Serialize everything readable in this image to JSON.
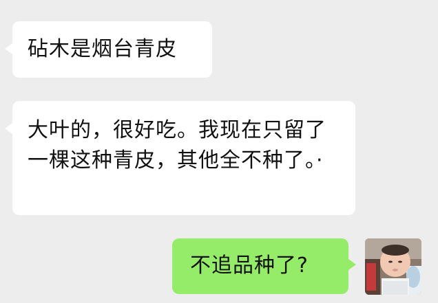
{
  "messages": [
    {
      "side": "received",
      "text": "砧木是烟台青皮"
    },
    {
      "side": "received",
      "text": "大叶的，很好吃。我现在只留了一棵这种青皮，其他全不种了。·"
    },
    {
      "side": "sent",
      "text": "不追品种了?"
    }
  ],
  "avatar": {
    "icon": "baby-photo-avatar"
  },
  "colors": {
    "background": "#ededed",
    "received_bubble": "#ffffff",
    "sent_bubble": "#95ec69",
    "text": "#111111"
  }
}
